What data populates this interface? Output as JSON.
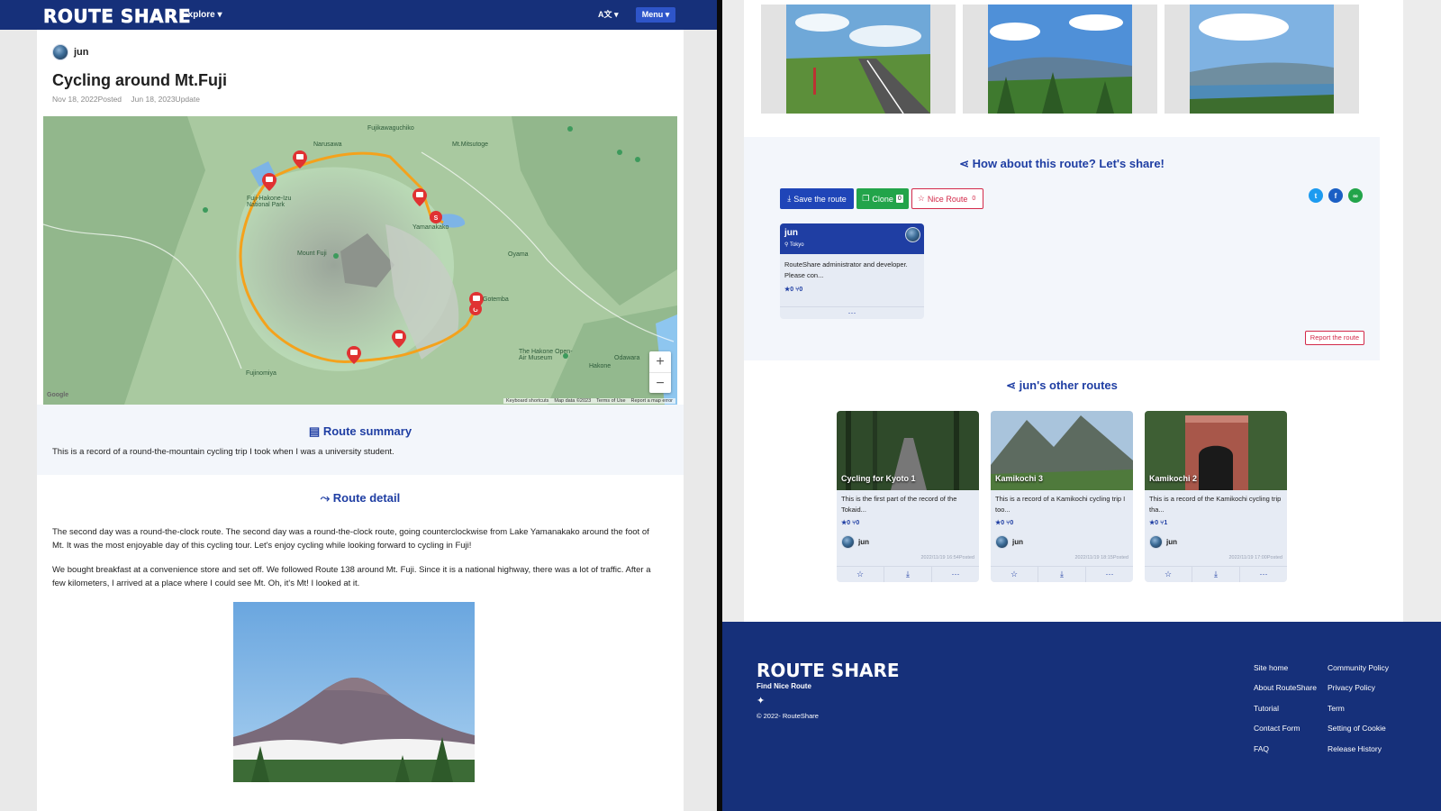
{
  "header": {
    "logo": "ROUTE SHARE",
    "explore": "Explore ▾",
    "lang": "A文 ▾",
    "menu": "Menu ▾"
  },
  "article": {
    "author": "jun",
    "title": "Cycling around Mt.Fuji",
    "posted": "Nov 18, 2022Posted",
    "updated": "Jun 18, 2023Update",
    "map": {
      "labels": [
        "Fuji-Hakone-Izu National Park",
        "Mount Fuji",
        "The Hakone Open-Air Museum",
        "Fujikawaguchiko",
        "Yamanakako",
        "Odawara",
        "Gotemba",
        "Fujinomiya",
        "Mt.Mitsutoge",
        "Narusawa",
        "Oyama",
        "Hakone"
      ],
      "attribution": [
        "Keyboard shortcuts",
        "Map data ©2023",
        "Terms of Use",
        "Report a map error"
      ],
      "zoom_in": "+",
      "zoom_out": "−",
      "google": "Google"
    },
    "summary": {
      "heading": "Route summary",
      "text": "This is a record of a round-the-mountain cycling trip I took when I was a university student."
    },
    "detail": {
      "heading": "Route detail",
      "p1": "The second day was a round-the-clock route. The second day was a round-the-clock route, going counterclockwise from Lake Yamanakako around the foot of Mt. It was the most enjoyable day of this cycling tour. Let's enjoy cycling while looking forward to cycling in Fuji!",
      "p2": "We bought breakfast at a convenience store and set off. We followed Route 138 around Mt. Fuji. Since it is a national highway, there was a lot of traffic. After a few kilometers, I arrived at a place where I could see Mt. Oh, it's Mt! I looked at it."
    }
  },
  "share": {
    "heading": "How about this route? Let's share!",
    "save": "Save the route",
    "clone": "Clone",
    "clone_count": "0",
    "nice": "Nice Route",
    "nice_count": "0",
    "report": "Report the route"
  },
  "user_card": {
    "name": "jun",
    "location": "Tokyo",
    "bio": "RouteShare administrator and developer. Please con...",
    "stars": "0",
    "forks": "0",
    "more": "···"
  },
  "others": {
    "heading": "jun's other routes",
    "routes": [
      {
        "title": "Cycling for Kyoto 1",
        "desc": "This is the first part of the record of the Tokaid...",
        "stars": "0",
        "forks": "0",
        "user": "jun",
        "date": "2022/11/19 16:54Posted"
      },
      {
        "title": "Kamikochi 3",
        "desc": "This is a record of a Kamikochi cycling trip I too...",
        "stars": "0",
        "forks": "0",
        "user": "jun",
        "date": "2022/11/19 18:15Posted"
      },
      {
        "title": "Kamikochi 2",
        "desc": "This is a record of the Kamikochi cycling trip tha...",
        "stars": "0",
        "forks": "1",
        "user": "jun",
        "date": "2022/11/19 17:00Posted"
      }
    ]
  },
  "footer": {
    "logo": "ROUTE SHARE",
    "tagline": "Find Nice Route",
    "copyright": "© 2022- RouteShare",
    "col1": [
      "Site home",
      "About RouteShare",
      "Tutorial",
      "Contact Form",
      "FAQ"
    ],
    "col2": [
      "Community Policy",
      "Privacy Policy",
      "Term",
      "Setting of Cookie",
      "Release History"
    ]
  },
  "colors": {
    "brand": "#16307a",
    "accent": "#1f3ea3",
    "clone": "#22a44a",
    "danger": "#d32a4a",
    "route": "#f4a21c"
  }
}
